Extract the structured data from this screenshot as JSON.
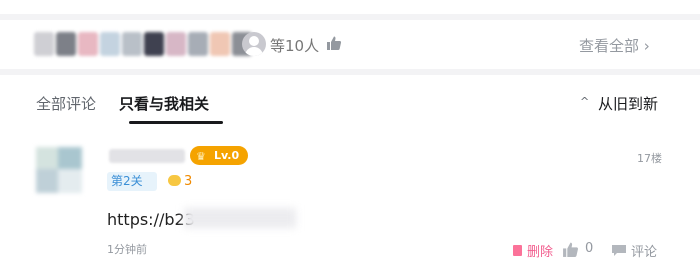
{
  "likes": {
    "text": "等10人",
    "view_all": "查看全部 ›",
    "icons": [
      "avatar-icon",
      "thumb-up-icon"
    ]
  },
  "tabs": {
    "all": "全部评论",
    "mine": "只看与我相关",
    "sort_label": "从旧到新",
    "sort_icon": "^"
  },
  "comment": {
    "level_badge": "Lv.0",
    "floor": "17楼",
    "level_tag": "第2关",
    "coin_count": "3",
    "text": "https://b23",
    "time": "1分钟前",
    "actions": {
      "delete": "删除",
      "like_count": "0",
      "reply": "评论"
    }
  },
  "colors": {
    "accent_pink": "#fb7299",
    "badge_gold": "#f5a300",
    "tag_blue": "#3b8fd6",
    "muted": "#9499a0"
  }
}
